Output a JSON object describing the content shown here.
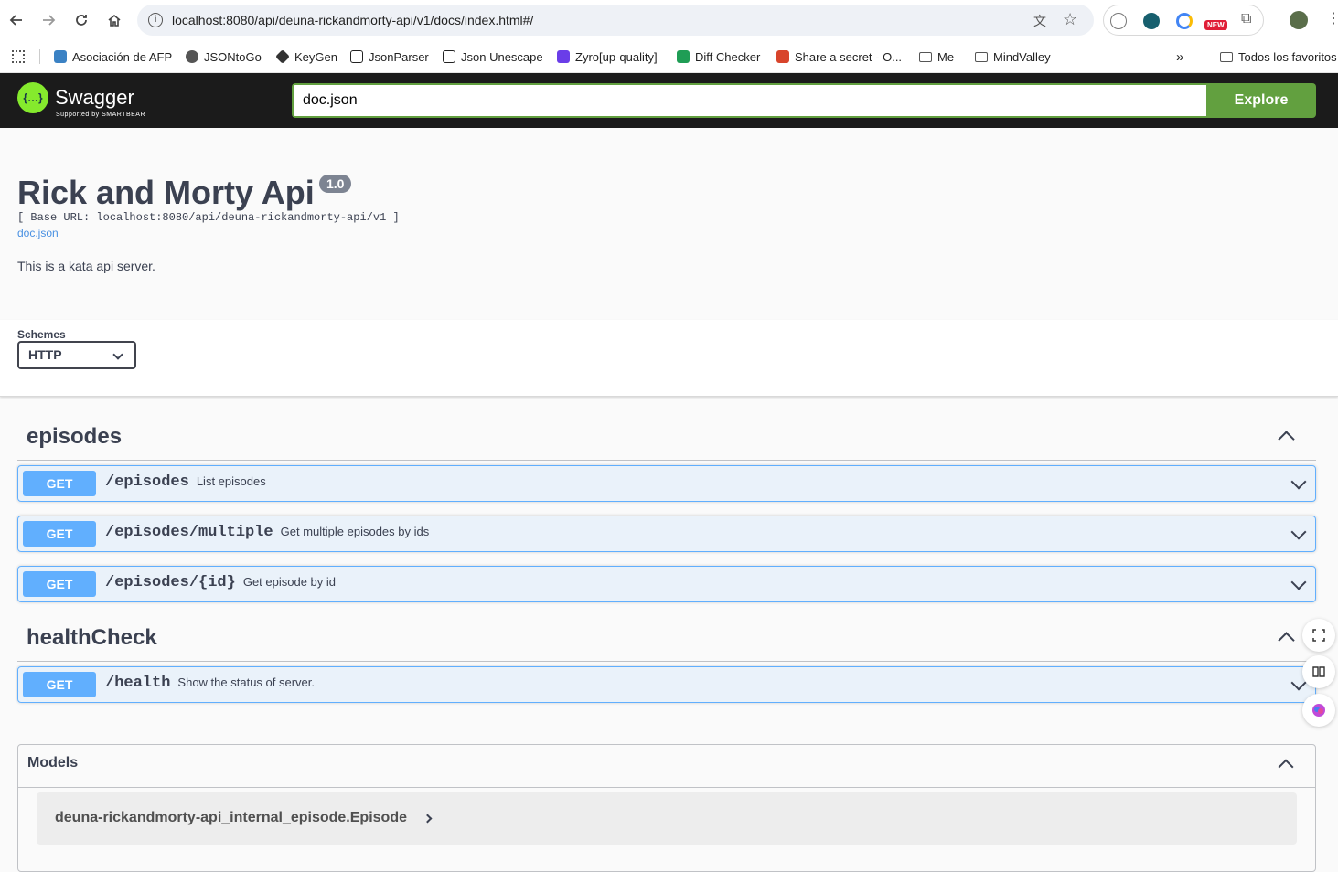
{
  "browser": {
    "url": "localhost:8080/api/deuna-rickandmorty-api/v1/docs/index.html#/",
    "badge_new": "NEW",
    "bookmarks": [
      {
        "label": "Asociación de AFP",
        "color": "#3b82c4"
      },
      {
        "label": "JSONtoGo",
        "color": "#555555"
      },
      {
        "label": "KeyGen",
        "color": "#333333"
      },
      {
        "label": "JsonParser",
        "color": "#222222"
      },
      {
        "label": "Json Unescape",
        "color": "#222222"
      },
      {
        "label": "Zyro[up-quality]",
        "color": "#6a3de8"
      },
      {
        "label": "Diff Checker",
        "color": "#1f9d55"
      },
      {
        "label": "Share a secret - O...",
        "color": "#d8442b"
      },
      {
        "label": "Me",
        "color": "#555555"
      },
      {
        "label": "MindValley",
        "color": "#555555"
      }
    ],
    "more_label": "»",
    "all_bookmarks": "Todos los favoritos"
  },
  "topbar": {
    "logo_text": "Swagger",
    "logo_sub": "Supported by SMARTBEAR",
    "spec_url": "doc.json",
    "explore_label": "Explore",
    "accent": "#62a03f"
  },
  "info": {
    "title": "Rick and Morty Api",
    "version": "1.0",
    "base_url": "[ Base URL: localhost:8080/api/deuna-rickandmorty-api/v1 ]",
    "doc_link": "doc.json",
    "description": "This is a kata api server."
  },
  "schemes": {
    "label": "Schemes",
    "selected": "HTTP"
  },
  "tags": [
    {
      "name": "episodes",
      "operations": [
        {
          "method": "GET",
          "path": "/episodes",
          "summary": "List episodes"
        },
        {
          "method": "GET",
          "path": "/episodes/multiple",
          "summary": "Get multiple episodes by ids"
        },
        {
          "method": "GET",
          "path": "/episodes/{id}",
          "summary": "Get episode by id"
        }
      ]
    },
    {
      "name": "healthCheck",
      "operations": [
        {
          "method": "GET",
          "path": "/health",
          "summary": "Show the status of server."
        }
      ]
    }
  ],
  "models": {
    "title": "Models",
    "items": [
      "deuna-rickandmorty-api_internal_episode.Episode"
    ]
  },
  "colors": {
    "get": "#61affe",
    "text": "#3b4151"
  }
}
